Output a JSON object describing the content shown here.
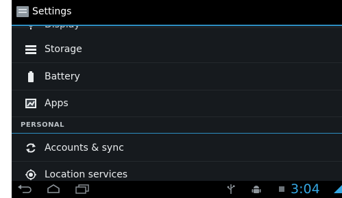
{
  "action_bar": {
    "title": "Settings"
  },
  "list": {
    "partial_item": "Display",
    "items": [
      {
        "label": "Storage",
        "icon": "storage-icon"
      },
      {
        "label": "Battery",
        "icon": "battery-icon"
      },
      {
        "label": "Apps",
        "icon": "apps-icon"
      }
    ],
    "section_header": "PERSONAL",
    "personal_items": [
      {
        "label": "Accounts & sync",
        "icon": "sync-icon"
      },
      {
        "label": "Location services",
        "icon": "location-icon"
      }
    ]
  },
  "nav_bar": {
    "buttons": [
      "back-icon",
      "home-icon",
      "recent-apps-icon"
    ],
    "clock": "3:04"
  },
  "colors": {
    "background": "#161a1e",
    "accent": "#2d8ec2",
    "clock": "#35a7e3",
    "text": "#e9ecee"
  }
}
